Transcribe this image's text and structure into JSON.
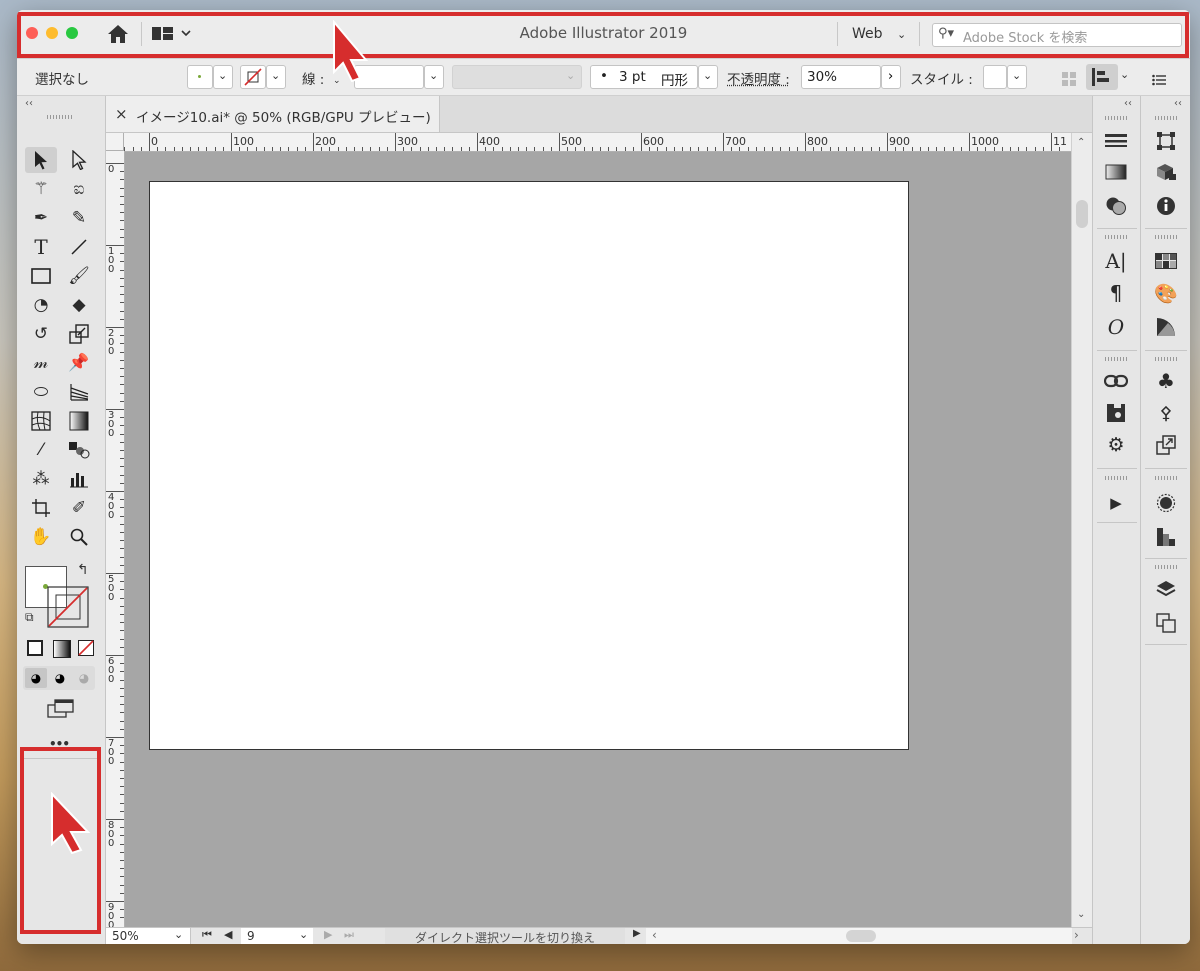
{
  "window": {
    "title": "Adobe Illustrator 2019",
    "workspace": "Web",
    "search_placeholder": "Adobe Stock を検索"
  },
  "control_bar": {
    "selection": "選択なし",
    "stroke_label": "線 :",
    "brush_size": "3 pt",
    "brush_shape": "円形",
    "opacity_label": "不透明度 :",
    "opacity_value": "30%",
    "style_label": "スタイル :"
  },
  "document_tab": {
    "close": "×",
    "label": "イメージ10.ai* @ 50% (RGB/GPU プレビュー)"
  },
  "rulers": {
    "horizontal": [
      "0",
      "100",
      "200",
      "300",
      "400",
      "500",
      "600",
      "700",
      "800",
      "900",
      "1000",
      "11"
    ],
    "vertical": [
      "0",
      "100",
      "200",
      "300",
      "400",
      "500",
      "600",
      "700",
      "800",
      "900"
    ]
  },
  "status_bar": {
    "zoom": "50%",
    "artboard_number": "9",
    "message": "ダイレクト選択ツールを切り換え"
  },
  "toolbar": {
    "more_tools": "•••",
    "collapse": "‹‹"
  },
  "colors": {
    "accent_red": "#d62d2d",
    "close_button": "#fe5f57",
    "minimize_button": "#febc2e",
    "zoom_button": "#28c840"
  }
}
